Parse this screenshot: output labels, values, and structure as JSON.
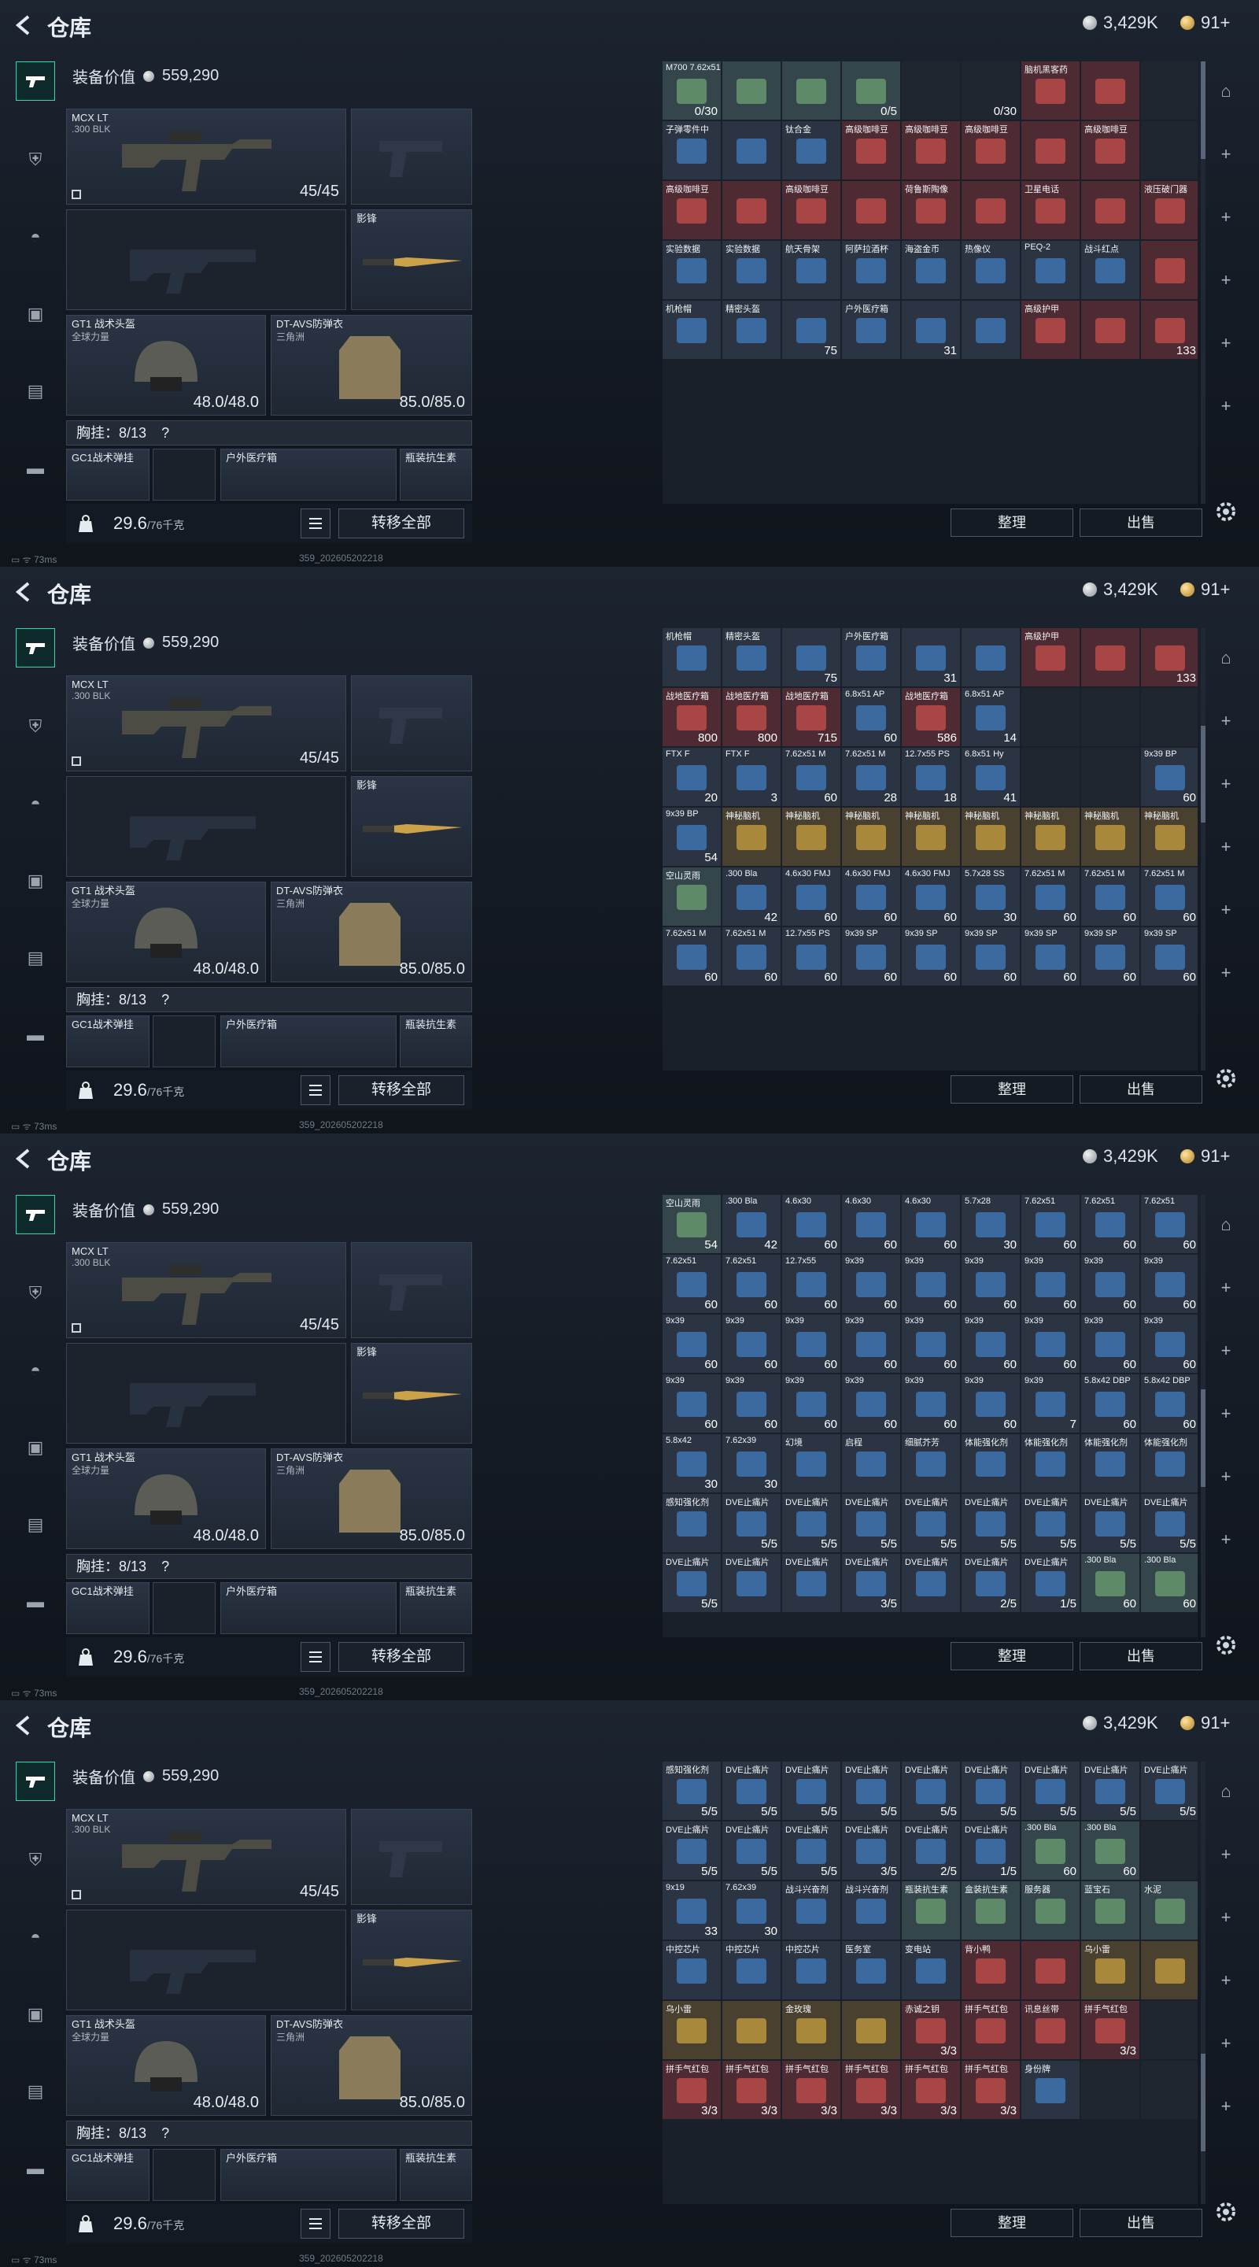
{
  "header": {
    "title": "仓库",
    "silver": "3,429K",
    "gold": "91+"
  },
  "loadout": {
    "value_label": "装备价值",
    "value": "559,290",
    "primary": {
      "name": "MCX LT",
      "sub": ".300 BLK",
      "ammo": "45/45"
    },
    "melee": {
      "name": "影锋"
    },
    "helmet": {
      "name": "GT1 战术头盔",
      "sub": "全球力量",
      "dur": "48.0/48.0"
    },
    "armor": {
      "name": "DT-AVS防弹衣",
      "sub": "三角洲",
      "dur": "85.0/85.0"
    },
    "vest": {
      "label": "胸挂：8/13",
      "help": "?"
    },
    "vest_items": [
      "GC1战术弹挂",
      "户外医疗箱",
      "瓶装抗生素"
    ],
    "weight": "29.6",
    "weight_max": "/76千克",
    "transfer": "转移全部"
  },
  "status": {
    "ping": "73ms",
    "id": "359_202605202218"
  },
  "buttons": {
    "sort": "整理",
    "sell": "出售"
  },
  "panels": [
    {
      "scroll": [
        0.0,
        0.22
      ],
      "items": [
        {
          "n": "M700 7.62x51mm",
          "q": "0/30",
          "c": "g"
        },
        {
          "n": "",
          "q": "",
          "c": "g"
        },
        {
          "n": "",
          "q": "",
          "c": "g"
        },
        {
          "n": "",
          "q": "0/5",
          "c": "g"
        },
        {
          "n": "",
          "q": "",
          "c": "e"
        },
        {
          "n": "",
          "q": "0/30",
          "c": "e"
        },
        {
          "n": "脑机黑客药",
          "q": "",
          "c": "r"
        },
        {
          "n": "",
          "q": "",
          "c": "r"
        },
        {
          "n": "",
          "q": "",
          "c": "e"
        },
        {
          "n": "子弹零件中",
          "q": "",
          "c": "b"
        },
        {
          "n": "",
          "q": "",
          "c": "b"
        },
        {
          "n": "钛合金",
          "q": "",
          "c": "b"
        },
        {
          "n": "高级咖啡豆",
          "q": "",
          "c": "r"
        },
        {
          "n": "高级咖啡豆",
          "q": "",
          "c": "r"
        },
        {
          "n": "高级咖啡豆",
          "q": "",
          "c": "r"
        },
        {
          "n": "",
          "q": "",
          "c": "r"
        },
        {
          "n": "高级咖啡豆",
          "q": "",
          "c": "r"
        },
        {
          "n": "",
          "q": "",
          "c": "e"
        },
        {
          "n": "高级咖啡豆",
          "q": "",
          "c": "r"
        },
        {
          "n": "",
          "q": "",
          "c": "r"
        },
        {
          "n": "高级咖啡豆",
          "q": "",
          "c": "r"
        },
        {
          "n": "",
          "q": "",
          "c": "r"
        },
        {
          "n": "荷鲁斯陶像",
          "q": "",
          "c": "r"
        },
        {
          "n": "",
          "q": "",
          "c": "r"
        },
        {
          "n": "卫星电话",
          "q": "",
          "c": "r"
        },
        {
          "n": "",
          "q": "",
          "c": "r"
        },
        {
          "n": "液压破门器",
          "q": "",
          "c": "r"
        },
        {
          "n": "实验数据",
          "q": "",
          "c": "b"
        },
        {
          "n": "实验数据",
          "q": "",
          "c": "b"
        },
        {
          "n": "航天骨架",
          "q": "",
          "c": "b"
        },
        {
          "n": "阿萨拉酒杯",
          "q": "",
          "c": "b"
        },
        {
          "n": "海盗金币",
          "q": "",
          "c": "b"
        },
        {
          "n": "热像仪",
          "q": "",
          "c": "b"
        },
        {
          "n": "PEQ-2",
          "q": "",
          "c": "b"
        },
        {
          "n": "战斗红点",
          "q": "",
          "c": "b"
        },
        {
          "n": "",
          "q": "",
          "c": "r"
        },
        {
          "n": "机枪帽",
          "q": "",
          "c": "b"
        },
        {
          "n": "精密头盔",
          "q": "",
          "c": "b"
        },
        {
          "n": "",
          "q": "75",
          "c": "b"
        },
        {
          "n": "户外医疗箱",
          "q": "",
          "c": "b"
        },
        {
          "n": "",
          "q": "31",
          "c": "b"
        },
        {
          "n": "",
          "q": "",
          "c": "b"
        },
        {
          "n": "高级护甲",
          "q": "",
          "c": "r"
        },
        {
          "n": "",
          "q": "",
          "c": "r"
        },
        {
          "n": "",
          "q": "133",
          "c": "r"
        }
      ]
    },
    {
      "scroll": [
        0.22,
        0.44
      ],
      "items": [
        {
          "n": "机枪帽",
          "q": "",
          "c": "b"
        },
        {
          "n": "精密头盔",
          "q": "",
          "c": "b"
        },
        {
          "n": "",
          "q": "75",
          "c": "b"
        },
        {
          "n": "户外医疗箱",
          "q": "",
          "c": "b"
        },
        {
          "n": "",
          "q": "31",
          "c": "b"
        },
        {
          "n": "",
          "q": "",
          "c": "b"
        },
        {
          "n": "高级护甲",
          "q": "",
          "c": "r"
        },
        {
          "n": "",
          "q": "",
          "c": "r"
        },
        {
          "n": "",
          "q": "133",
          "c": "r"
        },
        {
          "n": "战地医疗箱",
          "q": "800",
          "c": "r"
        },
        {
          "n": "战地医疗箱",
          "q": "800",
          "c": "r"
        },
        {
          "n": "战地医疗箱",
          "q": "715",
          "c": "r"
        },
        {
          "n": "6.8x51 AP",
          "q": "60",
          "c": "b"
        },
        {
          "n": "战地医疗箱",
          "q": "586",
          "c": "r"
        },
        {
          "n": "6.8x51 AP",
          "q": "14",
          "c": "b"
        },
        {
          "n": "",
          "q": "",
          "c": "e"
        },
        {
          "n": "",
          "q": "",
          "c": "e"
        },
        {
          "n": "",
          "q": "",
          "c": "e"
        },
        {
          "n": "FTX F",
          "q": "20",
          "c": "b"
        },
        {
          "n": "FTX F",
          "q": "3",
          "c": "b"
        },
        {
          "n": "7.62x51 M",
          "q": "60",
          "c": "b"
        },
        {
          "n": "7.62x51 M",
          "q": "28",
          "c": "b"
        },
        {
          "n": "12.7x55 PS",
          "q": "18",
          "c": "b"
        },
        {
          "n": "6.8x51 Hy",
          "q": "41",
          "c": "b"
        },
        {
          "n": "",
          "q": "",
          "c": "e"
        },
        {
          "n": "",
          "q": "",
          "c": "e"
        },
        {
          "n": "9x39 BP",
          "q": "60",
          "c": "b"
        },
        {
          "n": "9x39 BP",
          "q": "54",
          "c": "b"
        },
        {
          "n": "神秘脑机",
          "q": "",
          "c": "y"
        },
        {
          "n": "神秘脑机",
          "q": "",
          "c": "y"
        },
        {
          "n": "神秘脑机",
          "q": "",
          "c": "y"
        },
        {
          "n": "神秘脑机",
          "q": "",
          "c": "y"
        },
        {
          "n": "神秘脑机",
          "q": "",
          "c": "y"
        },
        {
          "n": "神秘脑机",
          "q": "",
          "c": "y"
        },
        {
          "n": "神秘脑机",
          "q": "",
          "c": "y"
        },
        {
          "n": "神秘脑机",
          "q": "",
          "c": "y"
        },
        {
          "n": "空山灵雨",
          "q": "",
          "c": "g"
        },
        {
          "n": ".300 Bla",
          "q": "42",
          "c": "b"
        },
        {
          "n": "4.6x30 FMJ",
          "q": "60",
          "c": "b"
        },
        {
          "n": "4.6x30 FMJ",
          "q": "60",
          "c": "b"
        },
        {
          "n": "4.6x30 FMJ",
          "q": "60",
          "c": "b"
        },
        {
          "n": "5.7x28 SS",
          "q": "30",
          "c": "b"
        },
        {
          "n": "7.62x51 M",
          "q": "60",
          "c": "b"
        },
        {
          "n": "7.62x51 M",
          "q": "60",
          "c": "b"
        },
        {
          "n": "7.62x51 M",
          "q": "60",
          "c": "b"
        },
        {
          "n": "7.62x51 M",
          "q": "60",
          "c": "b"
        },
        {
          "n": "7.62x51 M",
          "q": "60",
          "c": "b"
        },
        {
          "n": "12.7x55 PS",
          "q": "60",
          "c": "b"
        },
        {
          "n": "9x39 SP",
          "q": "60",
          "c": "b"
        },
        {
          "n": "9x39 SP",
          "q": "60",
          "c": "b"
        },
        {
          "n": "9x39 SP",
          "q": "60",
          "c": "b"
        },
        {
          "n": "9x39 SP",
          "q": "60",
          "c": "b"
        },
        {
          "n": "9x39 SP",
          "q": "60",
          "c": "b"
        },
        {
          "n": "9x39 SP",
          "q": "60",
          "c": "b"
        }
      ]
    },
    {
      "scroll": [
        0.44,
        0.66
      ],
      "items": [
        {
          "n": "空山灵雨",
          "q": "54",
          "c": "g"
        },
        {
          "n": ".300 Bla",
          "q": "42",
          "c": "b"
        },
        {
          "n": "4.6x30",
          "q": "60",
          "c": "b"
        },
        {
          "n": "4.6x30",
          "q": "60",
          "c": "b"
        },
        {
          "n": "4.6x30",
          "q": "60",
          "c": "b"
        },
        {
          "n": "5.7x28",
          "q": "30",
          "c": "b"
        },
        {
          "n": "7.62x51",
          "q": "60",
          "c": "b"
        },
        {
          "n": "7.62x51",
          "q": "60",
          "c": "b"
        },
        {
          "n": "7.62x51",
          "q": "60",
          "c": "b"
        },
        {
          "n": "7.62x51",
          "q": "60",
          "c": "b"
        },
        {
          "n": "7.62x51",
          "q": "60",
          "c": "b"
        },
        {
          "n": "12.7x55",
          "q": "60",
          "c": "b"
        },
        {
          "n": "9x39",
          "q": "60",
          "c": "b"
        },
        {
          "n": "9x39",
          "q": "60",
          "c": "b"
        },
        {
          "n": "9x39",
          "q": "60",
          "c": "b"
        },
        {
          "n": "9x39",
          "q": "60",
          "c": "b"
        },
        {
          "n": "9x39",
          "q": "60",
          "c": "b"
        },
        {
          "n": "9x39",
          "q": "60",
          "c": "b"
        },
        {
          "n": "9x39",
          "q": "60",
          "c": "b"
        },
        {
          "n": "9x39",
          "q": "60",
          "c": "b"
        },
        {
          "n": "9x39",
          "q": "60",
          "c": "b"
        },
        {
          "n": "9x39",
          "q": "60",
          "c": "b"
        },
        {
          "n": "9x39",
          "q": "60",
          "c": "b"
        },
        {
          "n": "9x39",
          "q": "60",
          "c": "b"
        },
        {
          "n": "9x39",
          "q": "60",
          "c": "b"
        },
        {
          "n": "9x39",
          "q": "60",
          "c": "b"
        },
        {
          "n": "9x39",
          "q": "60",
          "c": "b"
        },
        {
          "n": "9x39",
          "q": "60",
          "c": "b"
        },
        {
          "n": "9x39",
          "q": "60",
          "c": "b"
        },
        {
          "n": "9x39",
          "q": "60",
          "c": "b"
        },
        {
          "n": "9x39",
          "q": "60",
          "c": "b"
        },
        {
          "n": "9x39",
          "q": "60",
          "c": "b"
        },
        {
          "n": "9x39",
          "q": "60",
          "c": "b"
        },
        {
          "n": "9x39",
          "q": "7",
          "c": "b"
        },
        {
          "n": "5.8x42 DBP",
          "q": "60",
          "c": "b"
        },
        {
          "n": "5.8x42 DBP",
          "q": "60",
          "c": "b"
        },
        {
          "n": "5.8x42",
          "q": "30",
          "c": "b"
        },
        {
          "n": "7.62x39",
          "q": "30",
          "c": "b"
        },
        {
          "n": "幻境",
          "q": "",
          "c": "b"
        },
        {
          "n": "启程",
          "q": "",
          "c": "b"
        },
        {
          "n": "细腻芥芳",
          "q": "",
          "c": "b"
        },
        {
          "n": "体能强化剂",
          "q": "",
          "c": "b"
        },
        {
          "n": "体能强化剂",
          "q": "",
          "c": "b"
        },
        {
          "n": "体能强化剂",
          "q": "",
          "c": "b"
        },
        {
          "n": "体能强化剂",
          "q": "",
          "c": "b"
        },
        {
          "n": "感知强化剂",
          "q": "",
          "c": "b"
        },
        {
          "n": "DVE止痛片",
          "q": "5/5",
          "c": "b"
        },
        {
          "n": "DVE止痛片",
          "q": "5/5",
          "c": "b"
        },
        {
          "n": "DVE止痛片",
          "q": "5/5",
          "c": "b"
        },
        {
          "n": "DVE止痛片",
          "q": "5/5",
          "c": "b"
        },
        {
          "n": "DVE止痛片",
          "q": "5/5",
          "c": "b"
        },
        {
          "n": "DVE止痛片",
          "q": "5/5",
          "c": "b"
        },
        {
          "n": "DVE止痛片",
          "q": "5/5",
          "c": "b"
        },
        {
          "n": "DVE止痛片",
          "q": "5/5",
          "c": "b"
        },
        {
          "n": "DVE止痛片",
          "q": "5/5",
          "c": "b"
        },
        {
          "n": "DVE止痛片",
          "q": "",
          "c": "b"
        },
        {
          "n": "DVE止痛片",
          "q": "",
          "c": "b"
        },
        {
          "n": "DVE止痛片",
          "q": "3/5",
          "c": "b"
        },
        {
          "n": "DVE止痛片",
          "q": "",
          "c": "b"
        },
        {
          "n": "DVE止痛片",
          "q": "2/5",
          "c": "b"
        },
        {
          "n": "DVE止痛片",
          "q": "1/5",
          "c": "b"
        },
        {
          "n": ".300 Bla",
          "q": "60",
          "c": "g"
        },
        {
          "n": ".300 Bla",
          "q": "60",
          "c": "g"
        }
      ]
    },
    {
      "scroll": [
        0.66,
        0.88
      ],
      "items": [
        {
          "n": "感知强化剂",
          "q": "5/5",
          "c": "b"
        },
        {
          "n": "DVE止痛片",
          "q": "5/5",
          "c": "b"
        },
        {
          "n": "DVE止痛片",
          "q": "5/5",
          "c": "b"
        },
        {
          "n": "DVE止痛片",
          "q": "5/5",
          "c": "b"
        },
        {
          "n": "DVE止痛片",
          "q": "5/5",
          "c": "b"
        },
        {
          "n": "DVE止痛片",
          "q": "5/5",
          "c": "b"
        },
        {
          "n": "DVE止痛片",
          "q": "5/5",
          "c": "b"
        },
        {
          "n": "DVE止痛片",
          "q": "5/5",
          "c": "b"
        },
        {
          "n": "DVE止痛片",
          "q": "5/5",
          "c": "b"
        },
        {
          "n": "DVE止痛片",
          "q": "5/5",
          "c": "b"
        },
        {
          "n": "DVE止痛片",
          "q": "5/5",
          "c": "b"
        },
        {
          "n": "DVE止痛片",
          "q": "5/5",
          "c": "b"
        },
        {
          "n": "DVE止痛片",
          "q": "3/5",
          "c": "b"
        },
        {
          "n": "DVE止痛片",
          "q": "2/5",
          "c": "b"
        },
        {
          "n": "DVE止痛片",
          "q": "1/5",
          "c": "b"
        },
        {
          "n": ".300 Bla",
          "q": "60",
          "c": "g"
        },
        {
          "n": ".300 Bla",
          "q": "60",
          "c": "g"
        },
        {
          "n": "",
          "q": "",
          "c": "e"
        },
        {
          "n": "9x19",
          "q": "33",
          "c": "b"
        },
        {
          "n": "7.62x39",
          "q": "30",
          "c": "b"
        },
        {
          "n": "战斗兴奋剂",
          "q": "",
          "c": "b"
        },
        {
          "n": "战斗兴奋剂",
          "q": "",
          "c": "b"
        },
        {
          "n": "瓶装抗生素",
          "q": "",
          "c": "g"
        },
        {
          "n": "盒装抗生素",
          "q": "",
          "c": "g"
        },
        {
          "n": "服务器",
          "q": "",
          "c": "g"
        },
        {
          "n": "蓝宝石",
          "q": "",
          "c": "g"
        },
        {
          "n": "水泥",
          "q": "",
          "c": "g"
        },
        {
          "n": "中控芯片",
          "q": "",
          "c": "b"
        },
        {
          "n": "中控芯片",
          "q": "",
          "c": "b"
        },
        {
          "n": "中控芯片",
          "q": "",
          "c": "b"
        },
        {
          "n": "医务室",
          "q": "",
          "c": "b"
        },
        {
          "n": "变电站",
          "q": "",
          "c": "b"
        },
        {
          "n": "背小鸭",
          "q": "",
          "c": "r"
        },
        {
          "n": "",
          "q": "",
          "c": "r"
        },
        {
          "n": "乌小雷",
          "q": "",
          "c": "y"
        },
        {
          "n": "",
          "q": "",
          "c": "y"
        },
        {
          "n": "乌小雷",
          "q": "",
          "c": "y"
        },
        {
          "n": "",
          "q": "",
          "c": "y"
        },
        {
          "n": "金玫瑰",
          "q": "",
          "c": "y"
        },
        {
          "n": "",
          "q": "",
          "c": "y"
        },
        {
          "n": "赤诚之钥",
          "q": "3/3",
          "c": "r"
        },
        {
          "n": "拼手气红包",
          "q": "",
          "c": "r"
        },
        {
          "n": "讯息丝带",
          "q": "",
          "c": "r"
        },
        {
          "n": "拼手气红包",
          "q": "3/3",
          "c": "r"
        },
        {
          "n": "",
          "q": "",
          "c": "e"
        },
        {
          "n": "拼手气红包",
          "q": "3/3",
          "c": "r"
        },
        {
          "n": "拼手气红包",
          "q": "3/3",
          "c": "r"
        },
        {
          "n": "拼手气红包",
          "q": "3/3",
          "c": "r"
        },
        {
          "n": "拼手气红包",
          "q": "3/3",
          "c": "r"
        },
        {
          "n": "拼手气红包",
          "q": "3/3",
          "c": "r"
        },
        {
          "n": "拼手气红包",
          "q": "3/3",
          "c": "r"
        },
        {
          "n": "身份牌",
          "q": "",
          "c": "b"
        },
        {
          "n": "",
          "q": "",
          "c": "e"
        },
        {
          "n": "",
          "q": "",
          "c": "e"
        }
      ]
    }
  ],
  "colors": {
    "accent": "#2fd6b5",
    "red_cell": "#4e2a33",
    "blue_cell": "#2b3442"
  }
}
